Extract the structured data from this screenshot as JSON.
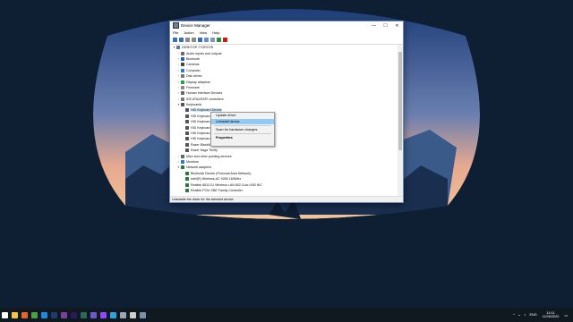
{
  "window": {
    "title": "Device Manager",
    "minimize_glyph": "—",
    "maximize_glyph": "☐",
    "close_glyph": "✕"
  },
  "menu": [
    "File",
    "Action",
    "View",
    "Help"
  ],
  "toolbar_icons": [
    "back-icon",
    "forward-icon",
    "grid-icon",
    "help-icon",
    "properties-icon",
    "monitor-icon",
    "update-driver-icon",
    "scan-icon",
    "uninstall-icon"
  ],
  "tree": [
    {
      "label": "DESKTOP-7TGRO7B",
      "arrow": "▾",
      "indent": 0,
      "icon": "#5a7ba0"
    },
    {
      "label": "Audio inputs and outputs",
      "arrow": "›",
      "indent": 1,
      "icon": "#6a6a6a"
    },
    {
      "label": "Bluetooth",
      "arrow": "›",
      "indent": 1,
      "icon": "#1a5fd1"
    },
    {
      "label": "Cameras",
      "arrow": "›",
      "indent": 1,
      "icon": "#444"
    },
    {
      "label": "Computer",
      "arrow": "›",
      "indent": 1,
      "icon": "#2f7ad8"
    },
    {
      "label": "Disk drives",
      "arrow": "›",
      "indent": 1,
      "icon": "#777"
    },
    {
      "label": "Display adaptors",
      "arrow": "›",
      "indent": 1,
      "icon": "#2a9d4a"
    },
    {
      "label": "Firmware",
      "arrow": "›",
      "indent": 1,
      "icon": "#888"
    },
    {
      "label": "Human Interface Devices",
      "arrow": "›",
      "indent": 1,
      "icon": "#666"
    },
    {
      "label": "IDE ATA/ATAPI controllers",
      "arrow": "›",
      "indent": 1,
      "icon": "#777"
    },
    {
      "label": "Keyboards",
      "arrow": "▾",
      "indent": 1,
      "icon": "#555"
    },
    {
      "label": "HID Keyboard Device",
      "arrow": "",
      "indent": 2,
      "icon": "#555",
      "selected": true
    },
    {
      "label": "HID Keyboard Device",
      "arrow": "",
      "indent": 2,
      "icon": "#555"
    },
    {
      "label": "HID Keyboard Device",
      "arrow": "",
      "indent": 2,
      "icon": "#555"
    },
    {
      "label": "HID Keyboard Device",
      "arrow": "",
      "indent": 2,
      "icon": "#555"
    },
    {
      "label": "HID Keyboard Device",
      "arrow": "",
      "indent": 2,
      "icon": "#555"
    },
    {
      "label": "HID Keyboard Device",
      "arrow": "",
      "indent": 2,
      "icon": "#555"
    },
    {
      "label": "Razer BlackWidow",
      "arrow": "",
      "indent": 2,
      "icon": "#555"
    },
    {
      "label": "Razer Naga Trinity",
      "arrow": "",
      "indent": 2,
      "icon": "#555"
    },
    {
      "label": "Mice and other pointing devices",
      "arrow": "›",
      "indent": 1,
      "icon": "#666"
    },
    {
      "label": "Monitors",
      "arrow": "›",
      "indent": 1,
      "icon": "#2f7ad8"
    },
    {
      "label": "Network adapters",
      "arrow": "▾",
      "indent": 1,
      "icon": "#2a7a3a"
    },
    {
      "label": "Bluetooth Device (Personal Area Network)",
      "arrow": "",
      "indent": 2,
      "icon": "#2a7a3a"
    },
    {
      "label": "Intel(R) Wireless-AC 9260 160MHz",
      "arrow": "",
      "indent": 2,
      "icon": "#2a7a3a"
    },
    {
      "label": "Realtek 8811CU Wireless LAN 802.11ac USB NIC",
      "arrow": "",
      "indent": 2,
      "icon": "#2a7a3a"
    },
    {
      "label": "Realtek PCIe GBE Family Controller",
      "arrow": "",
      "indent": 2,
      "icon": "#2a7a3a"
    }
  ],
  "context_menu": {
    "items": [
      {
        "label": "Update driver",
        "highlight": false,
        "bold": false
      },
      {
        "label": "Uninstall device",
        "highlight": true,
        "bold": false
      },
      {
        "label": "Scan for hardware changes",
        "highlight": false,
        "bold": false,
        "sep_before": true
      },
      {
        "label": "Properties",
        "highlight": false,
        "bold": true,
        "sep_before": true
      }
    ]
  },
  "status": "Uninstalls the driver for the selected device.",
  "taskbar": {
    "apps": [
      {
        "name": "windows-start-icon",
        "color": "#ffffff"
      },
      {
        "name": "file-explorer-icon",
        "color": "#f4c542"
      },
      {
        "name": "firefox-icon",
        "color": "#e8642b"
      },
      {
        "name": "chrome-icon",
        "color": "#4aa04a"
      },
      {
        "name": "settings-icon",
        "color": "#1e88e5"
      },
      {
        "name": "photoshop-icon",
        "color": "#1d3c6e"
      },
      {
        "name": "illustrator-icon",
        "color": "#7b3fa0"
      },
      {
        "name": "premiere-icon",
        "color": "#2b1b5a"
      },
      {
        "name": "audition-icon",
        "color": "#2a6a5a"
      },
      {
        "name": "headphones-icon",
        "color": "#6a5acd"
      },
      {
        "name": "twitch-icon",
        "color": "#9146ff"
      },
      {
        "name": "telegram-icon",
        "color": "#2aa5e0"
      },
      {
        "name": "steam-icon",
        "color": "#9aa5b5"
      },
      {
        "name": "obs-icon",
        "color": "#cfcfcf"
      },
      {
        "name": "device-manager-icon",
        "color": "#7a8fa8"
      }
    ],
    "tray": {
      "chevron": "^",
      "lang": "ENG",
      "time": "14:11",
      "date": "11/05/2020"
    }
  }
}
